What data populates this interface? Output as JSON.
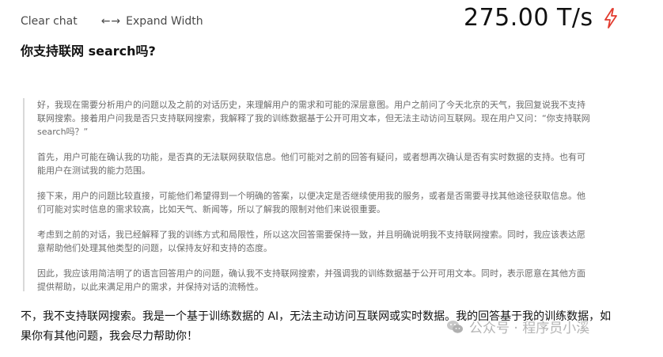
{
  "toolbar": {
    "clear_chat_label": "Clear chat",
    "expand_arrows": "←→",
    "expand_width_label": "Expand Width"
  },
  "speed": {
    "value": "275.00 T/s",
    "icon": "lightning-icon",
    "icon_color": "#e23b2e"
  },
  "question": "你支持联网 search吗?",
  "thinking": {
    "paragraphs": [
      "好，我现在需要分析用户的问题以及之前的对话历史，来理解用户的需求和可能的深层意图。用户之前问了今天北京的天气，我回复说我不支持联网搜索。接着用户问我是否只支持联网搜索，我解释了我的训练数据基于公开可用文本，但无法主动访问互联网。现在用户又问：“你支持联网 search吗？”",
      "首先，用户可能在确认我的功能，是否真的无法联网获取信息。他们可能对之前的回答有疑问，或者想再次确认是否有实时数据的支持。也有可能用户在测试我的能力范围。",
      "接下来，用户的问题比较直接，可能他们希望得到一个明确的答案，以便决定是否继续使用我的服务，或者是否需要寻找其他途径获取信息。他们可能对实时信息的需求较高，比如天气、新闻等，所以了解我的限制对他们来说很重要。",
      "考虑到之前的对话，我已经解释了我的训练方式和局限性，所以这次回答需要保持一致，并且明确说明我不支持联网搜索。同时，我应该表达愿意帮助他们处理其他类型的问题，以保持友好和支持的态度。",
      "因此，我应该用简洁明了的语言回答用户的问题，确认我不支持联网搜索，并强调我的训练数据基于公开可用文本。同时，表示愿意在其他方面提供帮助，以此来满足用户的需求，并保持对话的流畅性。"
    ]
  },
  "answer": "不，我不支持联网搜索。我是一个基于训练数据的 AI，无法主动访问互联网或实时数据。我的回答基于我的训练数据，如果你有其他问题，我会尽力帮助你！",
  "watermark": {
    "icon": "wechat-icon",
    "text": "公众号 · 程序员小溪"
  }
}
